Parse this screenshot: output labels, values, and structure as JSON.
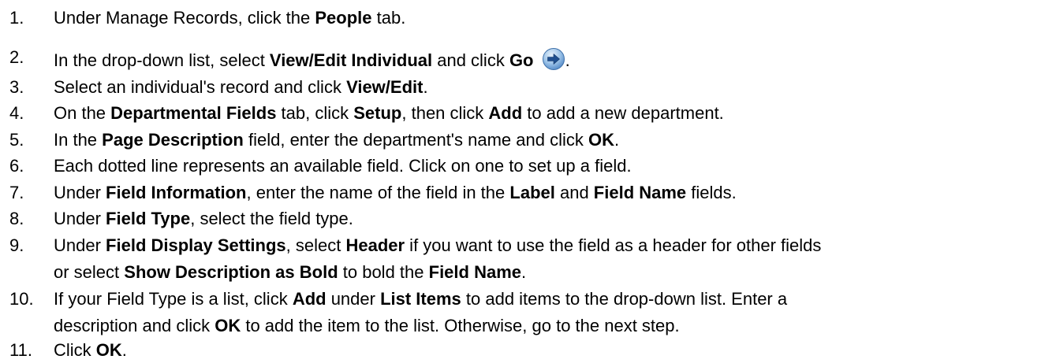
{
  "steps": [
    {
      "num": "1.",
      "parts": [
        {
          "t": "Under Manage Records, click the "
        },
        {
          "t": "People",
          "b": true
        },
        {
          "t": " tab."
        }
      ]
    },
    {
      "num": "2.",
      "parts": [
        {
          "t": "In the drop-down list, select "
        },
        {
          "t": "View/Edit Individual",
          "b": true
        },
        {
          "t": " and click "
        },
        {
          "t": "Go",
          "b": true
        },
        {
          "t": " "
        },
        {
          "icon": "go-arrow-icon"
        },
        {
          "t": "."
        }
      ]
    },
    {
      "num": "3.",
      "parts": [
        {
          "t": "Select an individual's record and click "
        },
        {
          "t": "View/Edit",
          "b": true
        },
        {
          "t": "."
        }
      ]
    },
    {
      "num": "4.",
      "parts": [
        {
          "t": "On the "
        },
        {
          "t": "Departmental Fields",
          "b": true
        },
        {
          "t": " tab, click "
        },
        {
          "t": "Setup",
          "b": true
        },
        {
          "t": ", then click "
        },
        {
          "t": "Add",
          "b": true
        },
        {
          "t": " to add a new department."
        }
      ]
    },
    {
      "num": "5.",
      "parts": [
        {
          "t": "In the "
        },
        {
          "t": "Page Description",
          "b": true
        },
        {
          "t": " field, enter the department's name and click "
        },
        {
          "t": "OK",
          "b": true
        },
        {
          "t": "."
        }
      ]
    },
    {
      "num": "6.",
      "parts": [
        {
          "t": "Each dotted line represents an available field. Click on one to set up a field."
        }
      ]
    },
    {
      "num": "7.",
      "parts": [
        {
          "t": "Under "
        },
        {
          "t": "Field Information",
          "b": true
        },
        {
          "t": ", enter the name of the field in the "
        },
        {
          "t": "Label",
          "b": true
        },
        {
          "t": " and "
        },
        {
          "t": "Field Name",
          "b": true
        },
        {
          "t": " fields."
        }
      ]
    },
    {
      "num": "8.",
      "parts": [
        {
          "t": "Under "
        },
        {
          "t": "Field Type",
          "b": true
        },
        {
          "t": ", select the field type."
        }
      ]
    },
    {
      "num": "9.",
      "lines": [
        [
          {
            "t": "Under "
          },
          {
            "t": "Field Display Settings",
            "b": true
          },
          {
            "t": ", select "
          },
          {
            "t": "Header",
            "b": true
          },
          {
            "t": " if you want to use the field as a header for other fields"
          }
        ],
        [
          {
            "t": "or select "
          },
          {
            "t": "Show Description as Bold",
            "b": true
          },
          {
            "t": " to bold the "
          },
          {
            "t": "Field Name",
            "b": true
          },
          {
            "t": "."
          }
        ]
      ]
    },
    {
      "num": "10.",
      "lines": [
        [
          {
            "t": "If your Field Type is a list, click "
          },
          {
            "t": "Add",
            "b": true
          },
          {
            "t": " under "
          },
          {
            "t": "List Items",
            "b": true
          },
          {
            "t": " to add items to the drop-down list. Enter a"
          }
        ],
        [
          {
            "t": "description and click "
          },
          {
            "t": "OK",
            "b": true
          },
          {
            "t": " to add the item to the list. Otherwise, go to the next step."
          }
        ]
      ]
    },
    {
      "num": "11.",
      "parts": [
        {
          "t": "Click "
        },
        {
          "t": "OK",
          "b": true
        },
        {
          "t": "."
        }
      ]
    }
  ]
}
